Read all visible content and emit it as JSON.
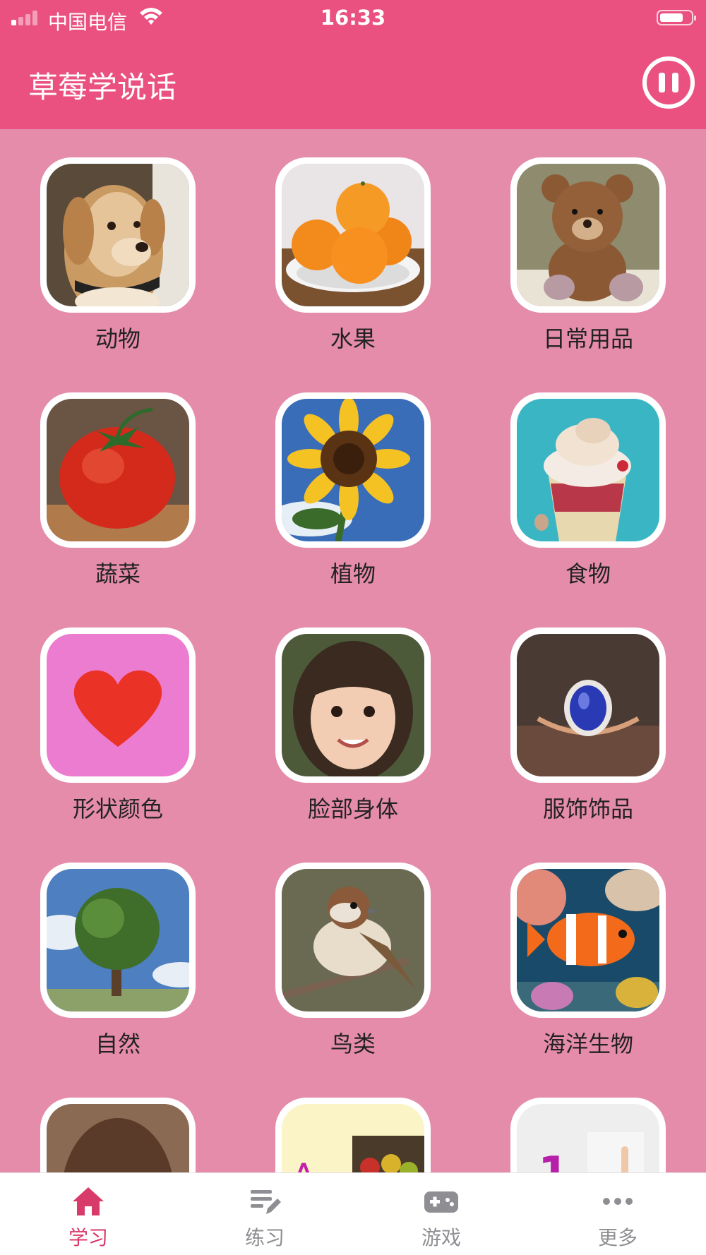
{
  "status_bar": {
    "carrier": "中国电信",
    "time": "16:33"
  },
  "header": {
    "title": "草莓学说话"
  },
  "categories": [
    {
      "label": "动物",
      "icon": "dog-photo"
    },
    {
      "label": "水果",
      "icon": "oranges-photo"
    },
    {
      "label": "日常用品",
      "icon": "teddy-bear-photo"
    },
    {
      "label": "蔬菜",
      "icon": "tomato-photo"
    },
    {
      "label": "植物",
      "icon": "sunflower-photo"
    },
    {
      "label": "食物",
      "icon": "ice-cream-photo"
    },
    {
      "label": "形状颜色",
      "icon": "heart-icon"
    },
    {
      "label": "脸部身体",
      "icon": "girl-face-photo"
    },
    {
      "label": "服饰饰品",
      "icon": "ring-photo"
    },
    {
      "label": "自然",
      "icon": "tree-photo"
    },
    {
      "label": "鸟类",
      "icon": "sparrow-photo"
    },
    {
      "label": "海洋生物",
      "icon": "clownfish-photo"
    },
    {
      "label": "",
      "icon": "girl-photo"
    },
    {
      "label": "",
      "icon": "letters-photo"
    },
    {
      "label": "",
      "icon": "numbers-photo"
    }
  ],
  "tabs": [
    {
      "label": "学习",
      "icon": "home-icon",
      "active": true
    },
    {
      "label": "练习",
      "icon": "edit-list-icon",
      "active": false
    },
    {
      "label": "游戏",
      "icon": "gamepad-icon",
      "active": false
    },
    {
      "label": "更多",
      "icon": "more-icon",
      "active": false
    }
  ],
  "colors": {
    "accent": "#ea5181",
    "background": "#e58cab",
    "active_tab": "#d83a6a",
    "inactive_tab": "#8e8e93"
  }
}
